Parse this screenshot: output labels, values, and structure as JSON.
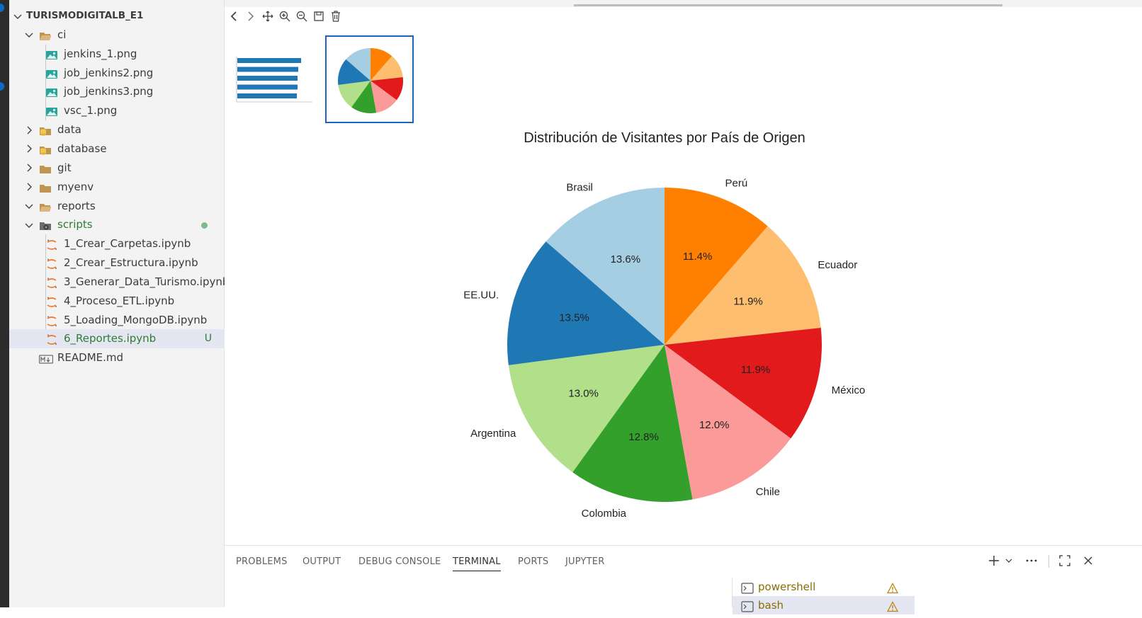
{
  "explorer": {
    "root_label": "TURISMODIGITALB_E1",
    "items": [
      {
        "label": "ci",
        "badge": ""
      },
      {
        "label": "jenkins_1.png",
        "badge": ""
      },
      {
        "label": "job_jenkins2.png",
        "badge": ""
      },
      {
        "label": "job_jenkins3.png",
        "badge": ""
      },
      {
        "label": "vsc_1.png",
        "badge": ""
      },
      {
        "label": "data",
        "badge": ""
      },
      {
        "label": "database",
        "badge": ""
      },
      {
        "label": "git",
        "badge": ""
      },
      {
        "label": "myenv",
        "badge": ""
      },
      {
        "label": "reports",
        "badge": ""
      },
      {
        "label": "scripts",
        "badge": ""
      },
      {
        "label": "1_Crear_Carpetas.ipynb",
        "badge": ""
      },
      {
        "label": "2_Crear_Estructura.ipynb",
        "badge": ""
      },
      {
        "label": "3_Generar_Data_Turismo.ipynb",
        "badge": ""
      },
      {
        "label": "4_Proceso_ETL.ipynb",
        "badge": ""
      },
      {
        "label": "5_Loading_MongoDB.ipynb",
        "badge": ""
      },
      {
        "label": "6_Reportes.ipynb",
        "badge": "U"
      },
      {
        "label": "README.md",
        "badge": ""
      }
    ]
  },
  "panel": {
    "tabs": [
      "PROBLEMS",
      "OUTPUT",
      "DEBUG CONSOLE",
      "TERMINAL",
      "PORTS",
      "JUPYTER"
    ],
    "active_tab": "TERMINAL",
    "terminals": [
      "powershell",
      "bash"
    ]
  },
  "colors": {
    "accent": "#1c64c4",
    "modified": "#81b88b",
    "untracked": "#2e7d32",
    "folder": "#c09553"
  },
  "chart_data": {
    "type": "pie",
    "title": "Distribución de Visitantes por País de Origen",
    "start_angle_deg": 90,
    "direction": "clockwise",
    "slices": [
      {
        "label": "Perú",
        "value": 11.4,
        "pct_label": "11.4%",
        "color": "#ff7f00"
      },
      {
        "label": "Ecuador",
        "value": 11.9,
        "pct_label": "11.9%",
        "color": "#fdbf6f"
      },
      {
        "label": "México",
        "value": 11.9,
        "pct_label": "11.9%",
        "color": "#e31a1c"
      },
      {
        "label": "Chile",
        "value": 12.0,
        "pct_label": "12.0%",
        "color": "#fb9a99"
      },
      {
        "label": "Colombia",
        "value": 12.8,
        "pct_label": "12.8%",
        "color": "#33a02c"
      },
      {
        "label": "Argentina",
        "value": 13.0,
        "pct_label": "13.0%",
        "color": "#b2df8a"
      },
      {
        "label": "EE.UU.",
        "value": 13.5,
        "pct_label": "13.5%",
        "color": "#1f78b4"
      },
      {
        "label": "Brasil",
        "value": 13.6,
        "pct_label": "13.6%",
        "color": "#a6cee3"
      }
    ]
  }
}
